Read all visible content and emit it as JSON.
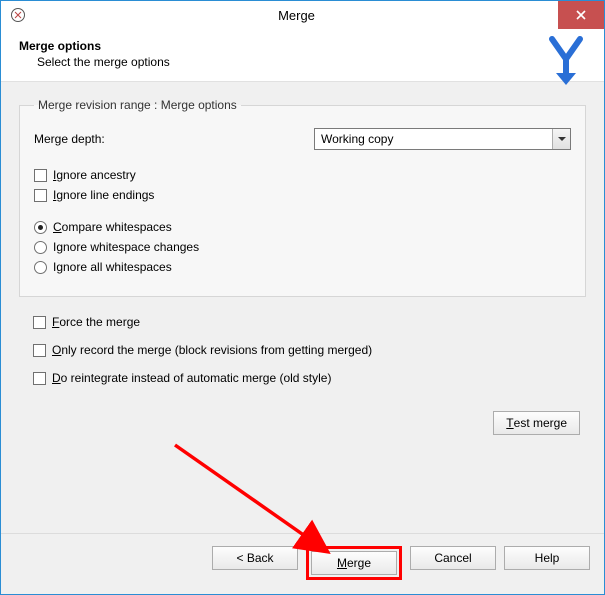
{
  "titlebar": {
    "title": "Merge"
  },
  "header": {
    "title": "Merge options",
    "subtitle": "Select the merge options"
  },
  "group": {
    "legend": "Merge revision range : Merge options",
    "depth_label": "Merge depth:",
    "depth_value": "Working copy",
    "chk_ignore_ancestry": "Ignore ancestry",
    "chk_ignore_line_endings": "Ignore line endings",
    "rad_compare_ws": "Compare whitespaces",
    "rad_ignore_ws_changes": "Ignore whitespace changes",
    "rad_ignore_all_ws": "Ignore all whitespaces"
  },
  "below": {
    "chk_force": "Force the merge",
    "chk_only_record": "Only record the merge (block revisions from getting merged)",
    "chk_reintegrate": "Do reintegrate instead of automatic merge (old style)"
  },
  "buttons": {
    "test_merge": "Test merge",
    "back": "<  Back",
    "merge": "Merge",
    "cancel": "Cancel",
    "help": "Help"
  }
}
